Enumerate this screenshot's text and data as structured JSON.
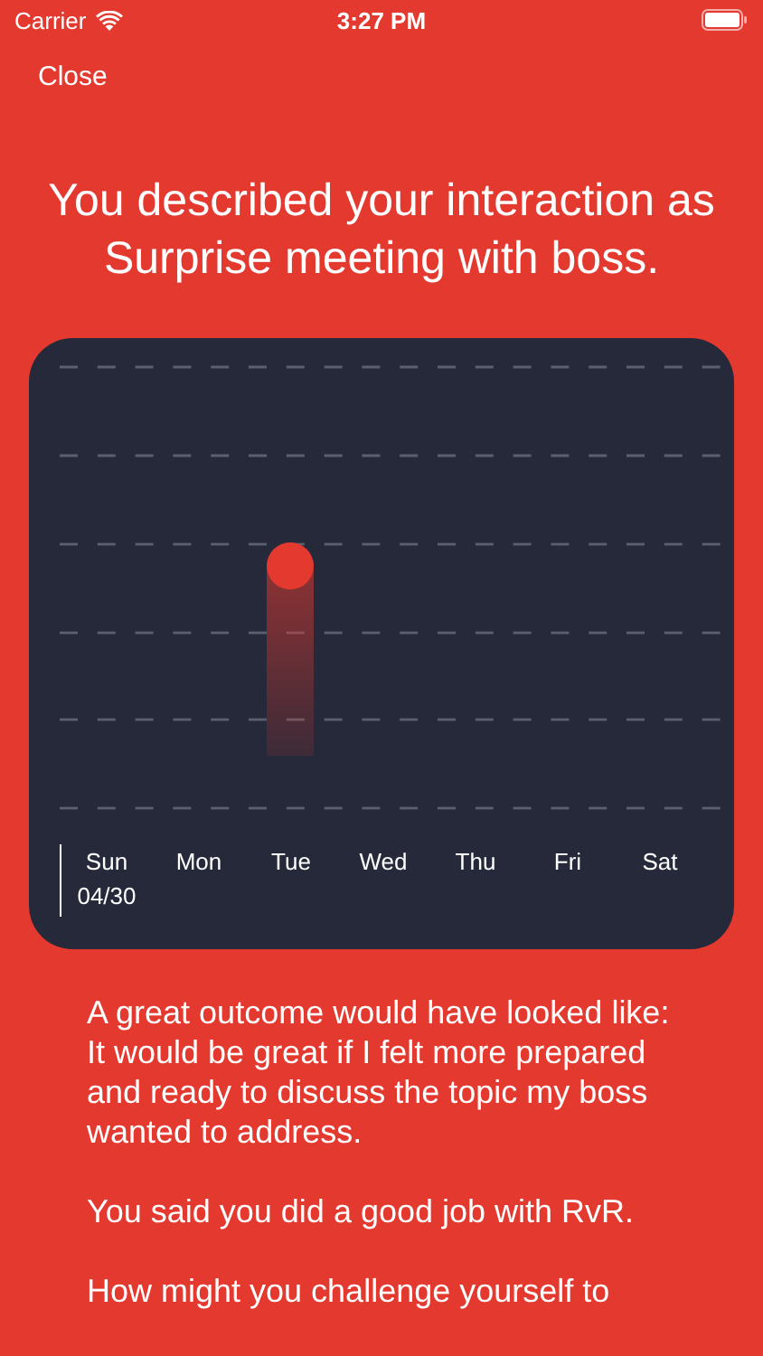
{
  "status_bar": {
    "carrier": "Carrier",
    "time": "3:27 PM"
  },
  "close_button": "Close",
  "heading": "You described your interaction as Surprise meeting with boss.",
  "week_chart": {
    "days": [
      {
        "label": "Sun",
        "date": "04/30",
        "selected": true,
        "entry": false
      },
      {
        "label": "Mon",
        "selected": false,
        "entry": false
      },
      {
        "label": "Tue",
        "selected": false,
        "entry": true
      },
      {
        "label": "Wed",
        "selected": false,
        "entry": false
      },
      {
        "label": "Thu",
        "selected": false,
        "entry": false
      },
      {
        "label": "Fri",
        "selected": false,
        "entry": false
      },
      {
        "label": "Sat",
        "selected": false,
        "entry": false
      }
    ]
  },
  "paragraphs": [
    "A great outcome would have looked like: It would be great if I felt more prepared and ready to discuss the topic my boss wanted to address.",
    "You said you did a good job with RvR.",
    "How might you challenge yourself to"
  ]
}
